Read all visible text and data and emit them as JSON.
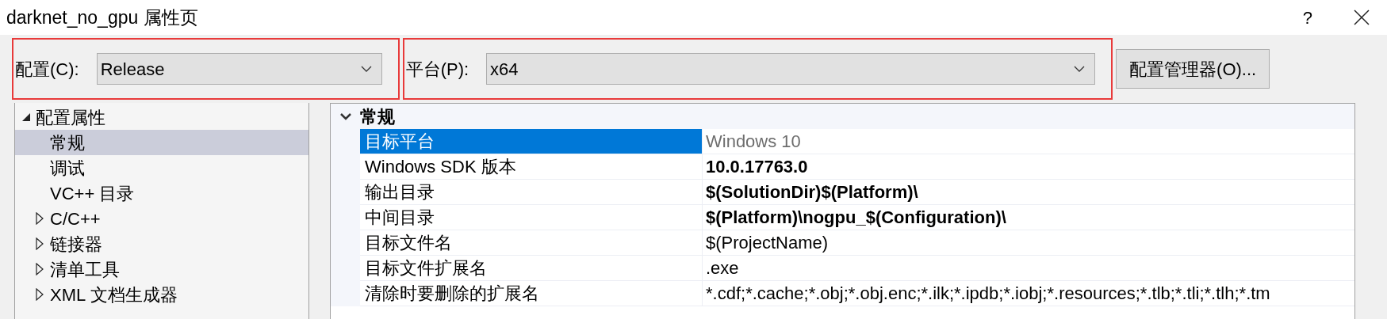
{
  "window": {
    "title": "darknet_no_gpu 属性页",
    "help": "?"
  },
  "toolbar": {
    "configuration": {
      "label": "配置(C):",
      "value": "Release",
      "highlighted": true
    },
    "platform": {
      "label": "平台(P):",
      "value": "x64",
      "highlighted": true
    },
    "manager_button": "配置管理器(O)..."
  },
  "tree": [
    {
      "label": "配置属性",
      "expanded": true,
      "selected": false,
      "children": [
        {
          "label": "常规",
          "selected": true
        },
        {
          "label": "调试",
          "selected": false
        },
        {
          "label": "VC++ 目录",
          "selected": false
        },
        {
          "label": "C/C++",
          "selected": false,
          "expanded": false
        },
        {
          "label": "链接器",
          "selected": false,
          "expanded": false
        },
        {
          "label": "清单工具",
          "selected": false,
          "expanded": false
        },
        {
          "label": "XML 文档生成器",
          "selected": false,
          "expanded": false
        }
      ]
    }
  ],
  "property_grid": {
    "category": {
      "label": "常规",
      "expanded": true
    },
    "rows": [
      {
        "name": "目标平台",
        "value": "Windows 10",
        "selected": true,
        "bold": false,
        "greyed": true
      },
      {
        "name": "Windows SDK 版本",
        "value": "10.0.17763.0",
        "selected": false,
        "bold": true,
        "greyed": false
      },
      {
        "name": "输出目录",
        "value": "$(SolutionDir)$(Platform)\\",
        "selected": false,
        "bold": true,
        "greyed": false
      },
      {
        "name": "中间目录",
        "value": "$(Platform)\\nogpu_$(Configuration)\\",
        "selected": false,
        "bold": true,
        "greyed": false
      },
      {
        "name": "目标文件名",
        "value": "$(ProjectName)",
        "selected": false,
        "bold": false,
        "greyed": false
      },
      {
        "name": "目标文件扩展名",
        "value": ".exe",
        "selected": false,
        "bold": false,
        "greyed": false
      },
      {
        "name": "清除时要删除的扩展名",
        "value": "*.cdf;*.cache;*.obj;*.obj.enc;*.ilk;*.ipdb;*.iobj;*.resources;*.tlb;*.tli;*.tlh;*.tm",
        "selected": false,
        "bold": false,
        "greyed": false
      }
    ]
  }
}
